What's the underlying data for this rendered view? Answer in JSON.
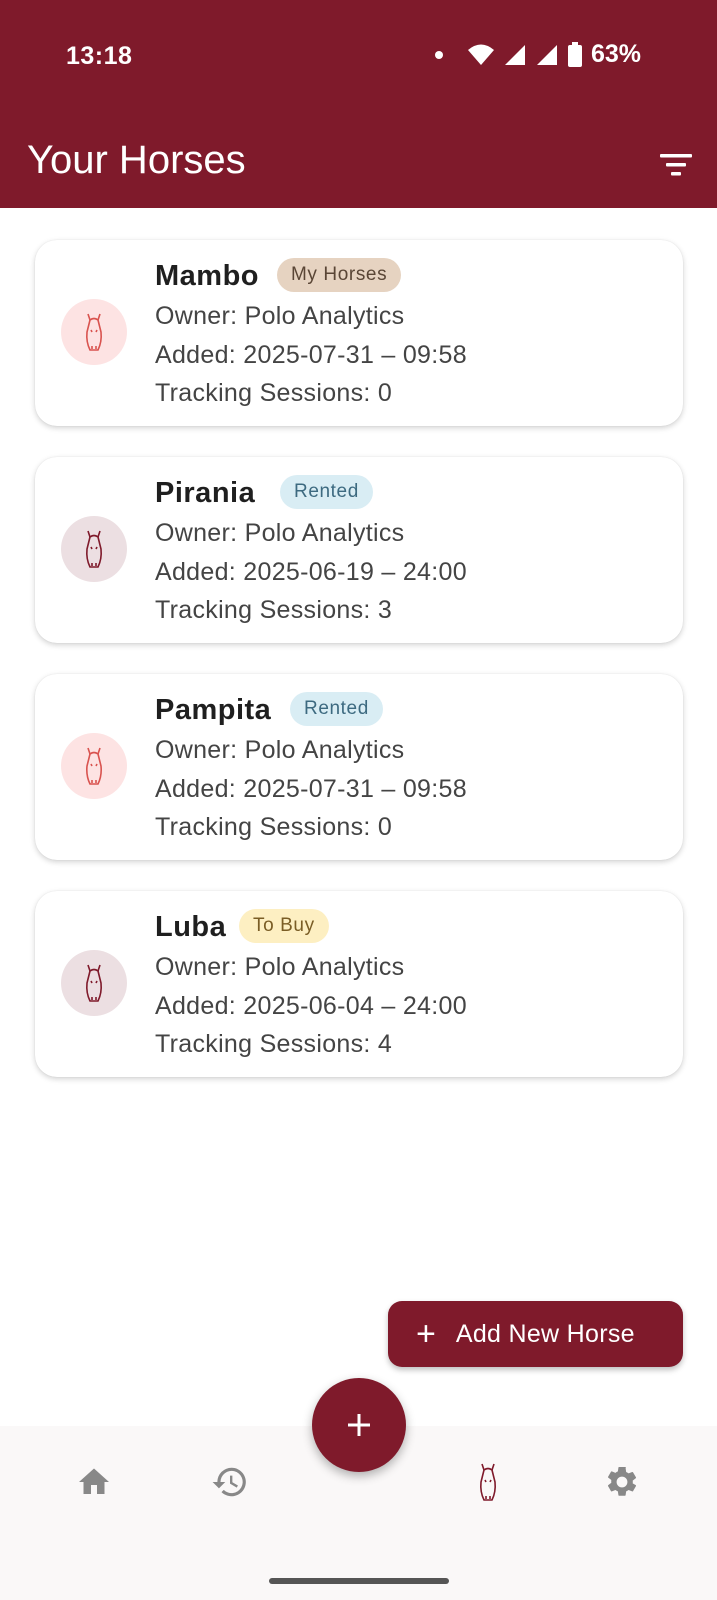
{
  "status_bar": {
    "time": "13:18",
    "battery_percent": "63%",
    "icons": [
      "notification-dot-icon",
      "wifi-icon",
      "signal-icon",
      "signal-icon",
      "battery-icon"
    ]
  },
  "app_bar": {
    "title": "Your Horses",
    "filter_icon": "filter-icon"
  },
  "horses": [
    {
      "name": "Mambo",
      "badge": "My Horses",
      "badge_type": "my",
      "owner": "Owner: Polo Analytics",
      "added": "Added: 2025-07-31 – 09:58",
      "sessions": "Tracking Sessions: 0",
      "avatar_color": "#fde3e3"
    },
    {
      "name": "Pirania",
      "badge": "Rented",
      "badge_type": "rented",
      "owner": "Owner: Polo Analytics",
      "added": "Added: 2025-06-19 – 24:00",
      "sessions": "Tracking Sessions: 3",
      "avatar_color": "#ecdfe2"
    },
    {
      "name": "Pampita",
      "badge": "Rented",
      "badge_type": "rented",
      "owner": "Owner: Polo Analytics",
      "added": "Added: 2025-07-31 – 09:58",
      "sessions": "Tracking Sessions: 0",
      "avatar_color": "#fde3e3"
    },
    {
      "name": "Luba",
      "badge": "To Buy",
      "badge_type": "buy",
      "owner": "Owner: Polo Analytics",
      "added": "Added: 2025-06-04 – 24:00",
      "sessions": "Tracking Sessions: 4",
      "avatar_color": "#ecdfe2"
    }
  ],
  "add_button": {
    "label": "Add New Horse",
    "icon": "plus-icon"
  },
  "fab": {
    "icon": "plus-icon"
  },
  "bottom_nav": {
    "items": [
      {
        "icon": "home-icon"
      },
      {
        "icon": "history-icon"
      },
      {
        "icon": "horse-icon",
        "active": true
      },
      {
        "icon": "settings-icon"
      }
    ]
  },
  "colors": {
    "primary": "#7f1a2b",
    "badge_my": "#e6d3c1",
    "badge_rented": "#d9edf4",
    "badge_buy": "#fdefc2",
    "nav_icon": "#888888"
  }
}
